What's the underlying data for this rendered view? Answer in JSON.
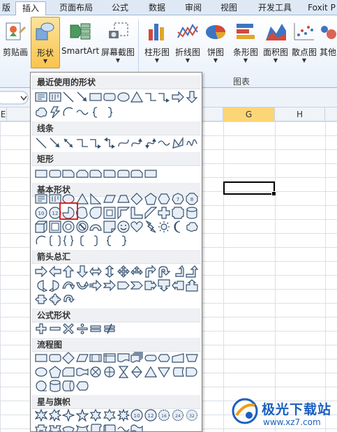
{
  "tabs": [
    {
      "label": "版",
      "active": false
    },
    {
      "label": "插入",
      "active": true
    },
    {
      "label": "页面布局",
      "active": false
    },
    {
      "label": "公式",
      "active": false
    },
    {
      "label": "数据",
      "active": false
    },
    {
      "label": "审阅",
      "active": false
    },
    {
      "label": "视图",
      "active": false
    },
    {
      "label": "开发工具",
      "active": false
    },
    {
      "label": "Foxit P",
      "active": false
    }
  ],
  "ribbon": {
    "clip_art": {
      "label": "剪贴画",
      "icon": "clip-art-icon"
    },
    "shapes": {
      "label": "形状",
      "icon": "shapes-icon",
      "pressed": true
    },
    "smartart": {
      "label": "SmartArt",
      "icon": "smartart-icon"
    },
    "screenshot": {
      "label": "屏幕截图",
      "icon": "screenshot-icon"
    },
    "charts": [
      {
        "label": "柱形图",
        "icon": "column-chart-icon"
      },
      {
        "label": "折线图",
        "icon": "line-chart-icon"
      },
      {
        "label": "饼图",
        "icon": "pie-chart-icon"
      },
      {
        "label": "条形图",
        "icon": "bar-chart-icon"
      },
      {
        "label": "面积图",
        "icon": "area-chart-icon"
      },
      {
        "label": "散点图",
        "icon": "scatter-chart-icon"
      },
      {
        "label": "其他",
        "icon": "other-chart-icon"
      }
    ],
    "chart_group_label": "图表"
  },
  "sheet": {
    "columns": [
      "E",
      "G",
      "H"
    ],
    "selected_column": "G",
    "accent": "#fbd676"
  },
  "dropdown": {
    "sections": [
      {
        "title": "最近使用的形状"
      },
      {
        "title": "线条"
      },
      {
        "title": "矩形"
      },
      {
        "title": "基本形状"
      },
      {
        "title": "箭头总汇"
      },
      {
        "title": "公式形状"
      },
      {
        "title": "流程图"
      },
      {
        "title": "星与旗帜"
      }
    ],
    "highlight_color": "#e02020"
  },
  "watermark": {
    "title": "极光下载站",
    "url": "www.xz7.com"
  }
}
